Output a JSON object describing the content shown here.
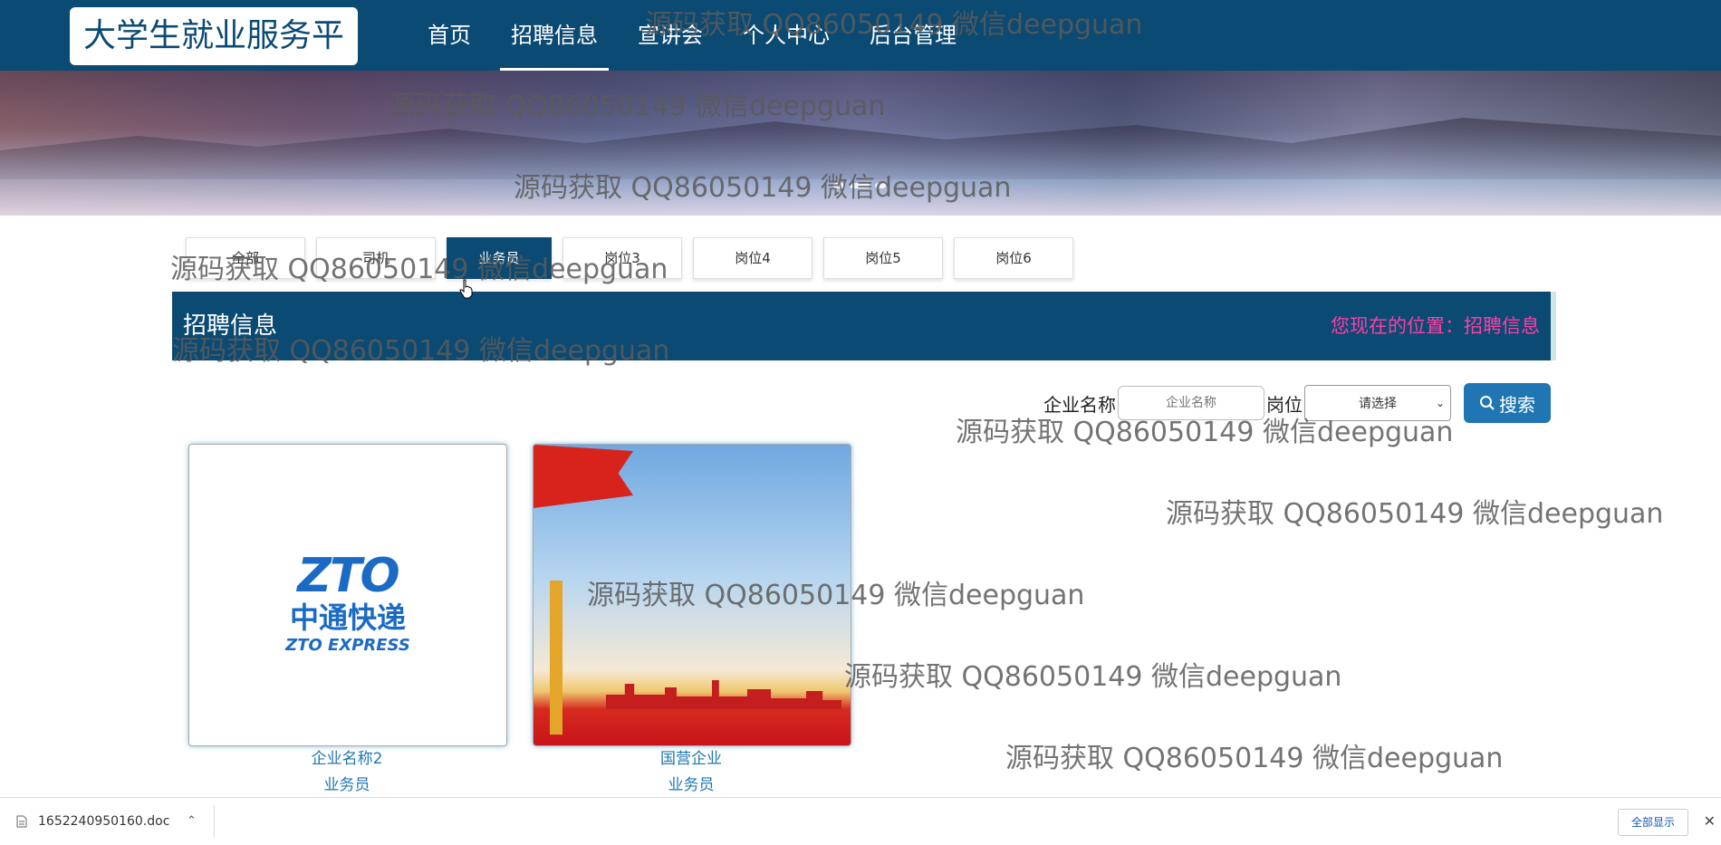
{
  "header": {
    "logo": "大学生就业服务平台",
    "nav": [
      "首页",
      "招聘信息",
      "宣讲会",
      "个人中心",
      "后台管理"
    ],
    "active_nav": "招聘信息"
  },
  "tabs": [
    "全部",
    "司机",
    "业务员",
    "岗位3",
    "岗位4",
    "岗位5",
    "岗位6"
  ],
  "active_tab": "业务员",
  "section": {
    "title": "招聘信息",
    "location": "您现在的位置：招聘信息"
  },
  "search": {
    "company_label": "企业名称",
    "company_placeholder": "企业名称",
    "position_label": "岗位",
    "position_selected": "请选择",
    "button": "搜索"
  },
  "cards": [
    {
      "name": "企业名称2",
      "position": "业务员",
      "logo_text": "ZTO",
      "logo_cn": "中通快递",
      "logo_en": "ZTO EXPRESS"
    },
    {
      "name": "国营企业",
      "position": "业务员"
    }
  ],
  "watermark": "源码获取 QQ86050149 微信deepguan",
  "download": {
    "filename": "1652240950160.doc",
    "show_all": "全部显示"
  },
  "colors": {
    "primary": "#0b4a72",
    "accent_pink": "#ff3ea5",
    "button_blue": "#1f76b2"
  }
}
